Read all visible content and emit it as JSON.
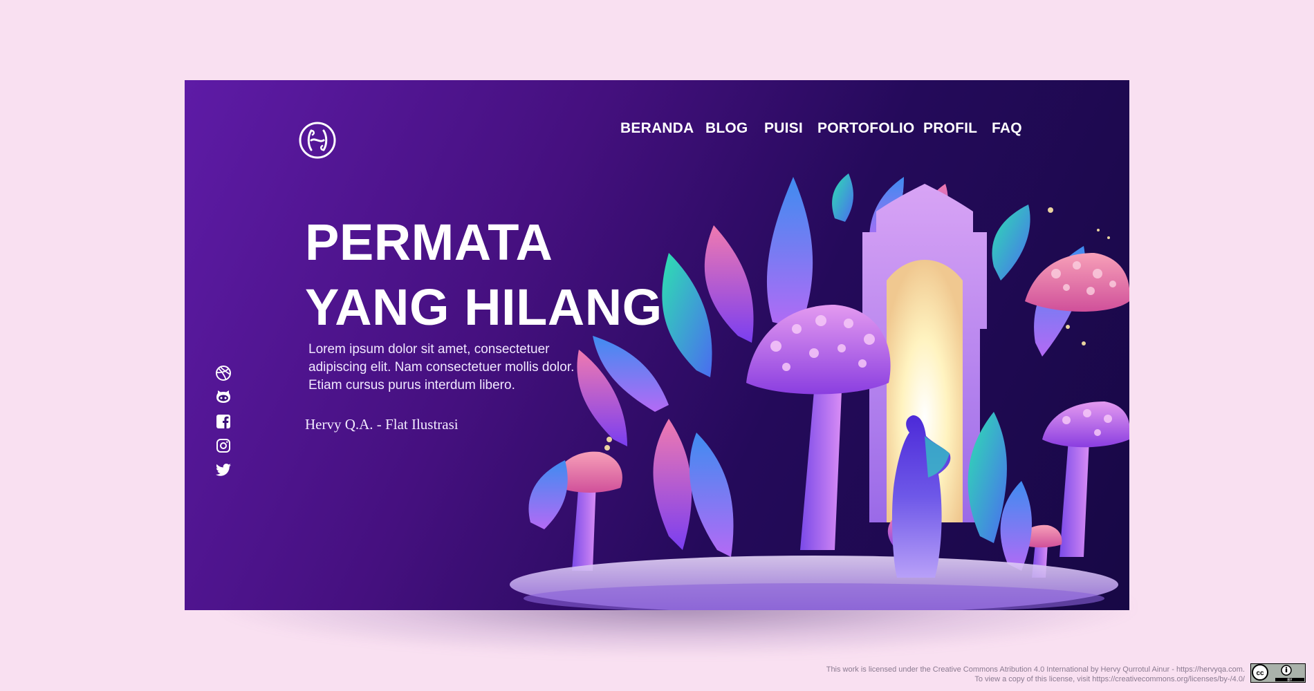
{
  "nav": {
    "items": [
      {
        "label": "BERANDA"
      },
      {
        "label": "BLOG"
      },
      {
        "label": "PUISI"
      },
      {
        "label": "PORTOFOLIO"
      },
      {
        "label": "PROFIL"
      },
      {
        "label": "FAQ"
      }
    ]
  },
  "hero": {
    "title_line1": "PERMATA",
    "title_line2": "YANG HILANG",
    "description": "Lorem ipsum dolor sit amet, consectetuer adipiscing elit. Nam consectetuer mollis dolor. Etiam cursus purus interdum libero.",
    "author": "Hervy Q.A. - Flat Ilustrasi"
  },
  "social": {
    "icons": [
      "dribbble-icon",
      "github-icon",
      "facebook-icon",
      "instagram-icon",
      "twitter-icon"
    ]
  },
  "license": {
    "line1": "This work is licensed under the Creative Commons Atribution 4.0 International by Hervy Qurrotul Ainur - https://hervyqa.com.",
    "line2": "To view a copy of this license, visit https://creativecommons.org/licenses/by-/4.0/",
    "badge_text": "BY"
  },
  "colors": {
    "page_bg": "#f9e0f1",
    "hero_gradient_start": "#5e1ba6",
    "hero_gradient_end": "#170845",
    "text": "#ffffff"
  }
}
